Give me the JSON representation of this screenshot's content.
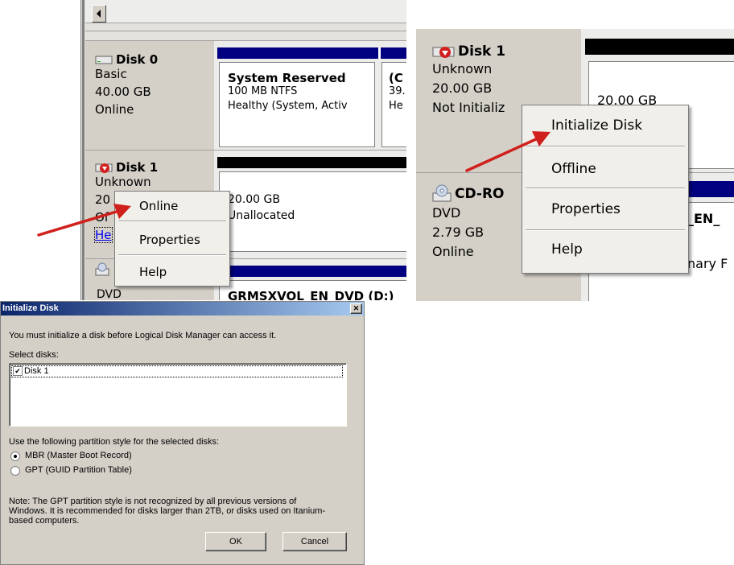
{
  "left_panel": {
    "disk0": {
      "name": "Disk 0",
      "type": "Basic",
      "size": "40.00 GB",
      "status": "Online",
      "partition1": {
        "name": "System Reserved",
        "fs": "100 MB NTFS",
        "status": "Healthy (System, Activ"
      },
      "partition2": {
        "name": "(C",
        "size": "39.",
        "status": "He"
      }
    },
    "disk1": {
      "name": "Disk 1",
      "type": "Unknown",
      "size_partial": "20",
      "status_partial": "Of",
      "link_partial": "He",
      "unallocated_size": "20.00 GB",
      "unallocated_label": "Unallocated"
    },
    "dvd": {
      "type": "DVD",
      "volume_label": "GRMSXVOL_EN_DVD (D:)"
    },
    "context_menu": {
      "items": [
        "Online",
        "Properties",
        "Help"
      ]
    }
  },
  "right_panel": {
    "disk1": {
      "name": "Disk 1",
      "type": "Unknown",
      "size": "20.00 GB",
      "status": "Not Initializ",
      "partition_size": "20.00 GB"
    },
    "cdrom": {
      "name": "CD-RO",
      "type": "DVD",
      "size": "2.79 GB",
      "status": "Online",
      "partial_label": "_EN_",
      "partial_status": "nary F"
    },
    "context_menu": {
      "items": [
        "Initialize Disk",
        "Offline",
        "Properties",
        "Help"
      ]
    }
  },
  "dialog": {
    "title": "Initialize Disk",
    "close_label": "✕",
    "intro": "You must initialize a disk before Logical Disk Manager can access it.",
    "select_label": "Select disks:",
    "disks": [
      {
        "label": "Disk 1",
        "checked": true
      }
    ],
    "style_label": "Use the following partition style for the selected disks:",
    "options": [
      {
        "label": "MBR (Master Boot Record)",
        "selected": true
      },
      {
        "label": "GPT (GUID Partition Table)",
        "selected": false
      }
    ],
    "note": "Note: The GPT partition style is not recognized by all previous versions of Windows. It is recommended for disks larger than 2TB, or disks used on Itanium-based computers.",
    "ok_label": "OK",
    "cancel_label": "Cancel"
  },
  "colors": {
    "partition_bar_blue": "#000080",
    "unallocated_bar": "#000000",
    "arrow_red": "#d0201c",
    "panel_bg": "#d4d0c8"
  },
  "icons": [
    "disk-icon",
    "unknown-disk-icon",
    "cdrom-icon",
    "checkbox",
    "radio",
    "close-icon",
    "scroll-left-arrow-icon"
  ]
}
